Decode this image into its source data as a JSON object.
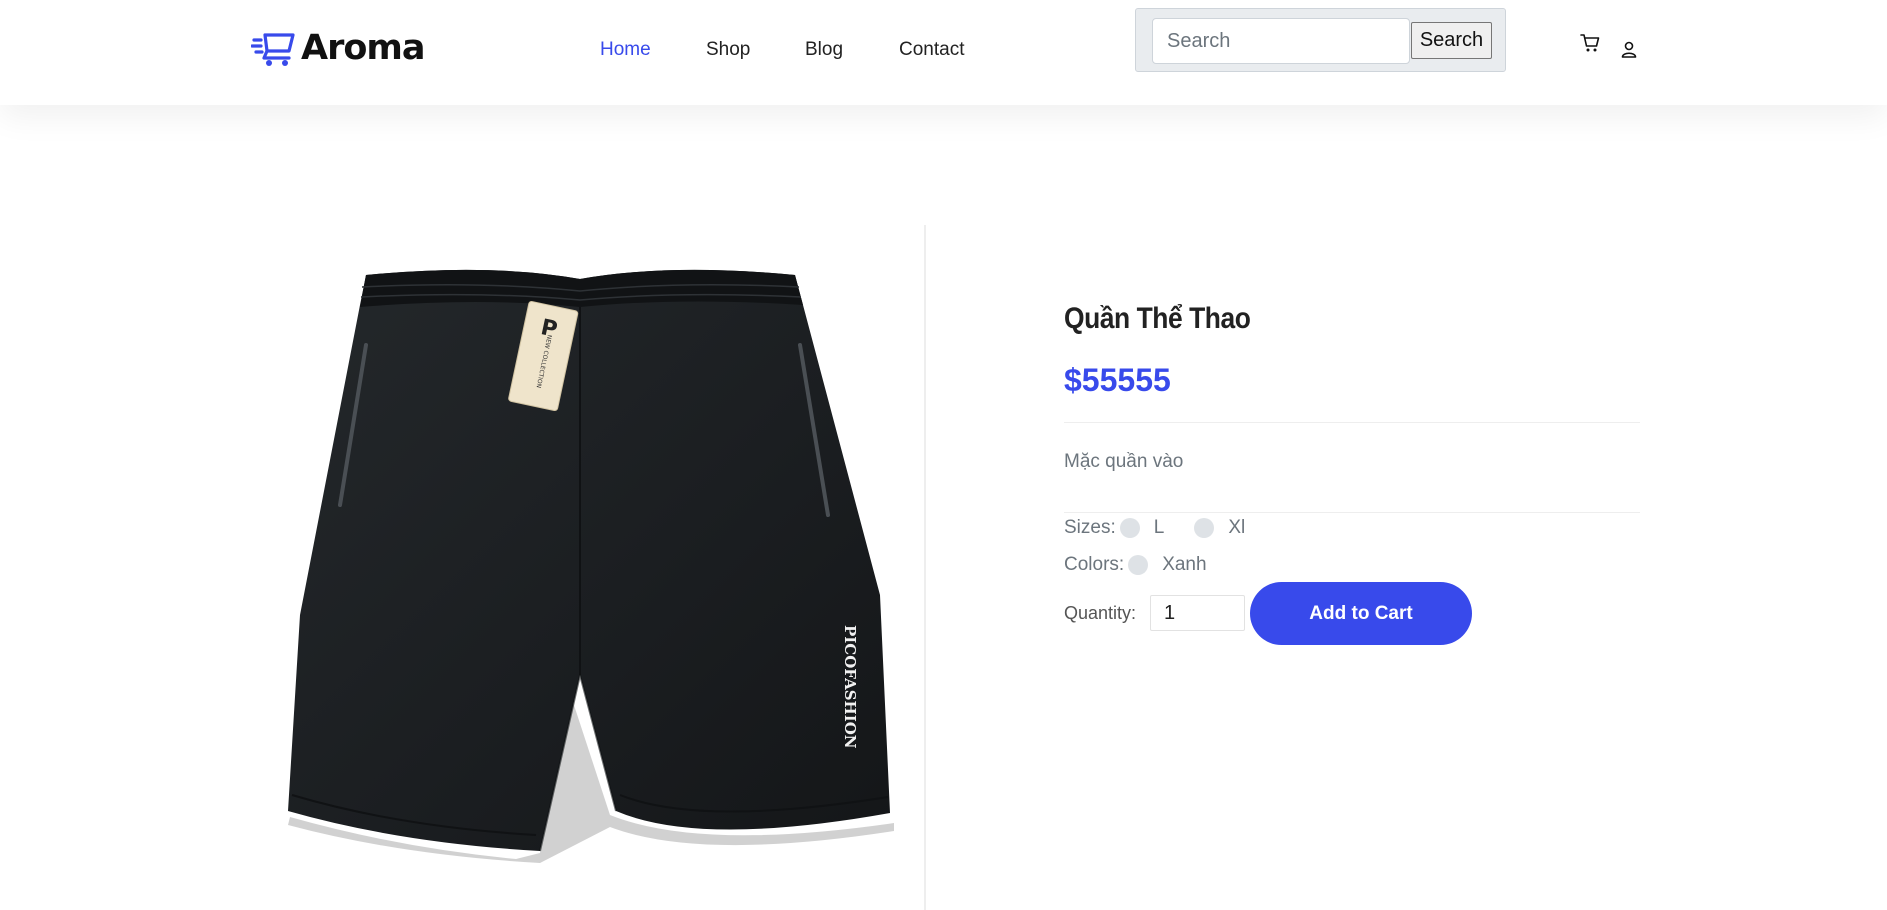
{
  "brand": {
    "name": "Aroma",
    "accent": "#384aeb",
    "icon": "shopping-cart-speed-icon"
  },
  "nav": {
    "items": [
      {
        "label": "Home",
        "active": true
      },
      {
        "label": "Shop",
        "active": false
      },
      {
        "label": "Blog",
        "active": false
      },
      {
        "label": "Contact",
        "active": false
      }
    ]
  },
  "search": {
    "placeholder": "Search",
    "value": "",
    "button_label": "Search"
  },
  "header_icons": [
    "cart-icon",
    "user-icon"
  ],
  "product": {
    "title": "Quần Thể Thao",
    "price": "$55555",
    "description": "Mặc quần vào",
    "image": {
      "alt": "Black athletic shorts",
      "tag_brand_mark": "P",
      "tag_text": "NEW COLLECTION",
      "leg_print": "PICOFASHION"
    },
    "sizes_label": "Sizes:",
    "sizes": [
      "L",
      "Xl"
    ],
    "colors_label": "Colors:",
    "colors": [
      "Xanh"
    ],
    "quantity_label": "Quantity:",
    "quantity": "1",
    "add_to_cart_label": "Add to Cart"
  }
}
